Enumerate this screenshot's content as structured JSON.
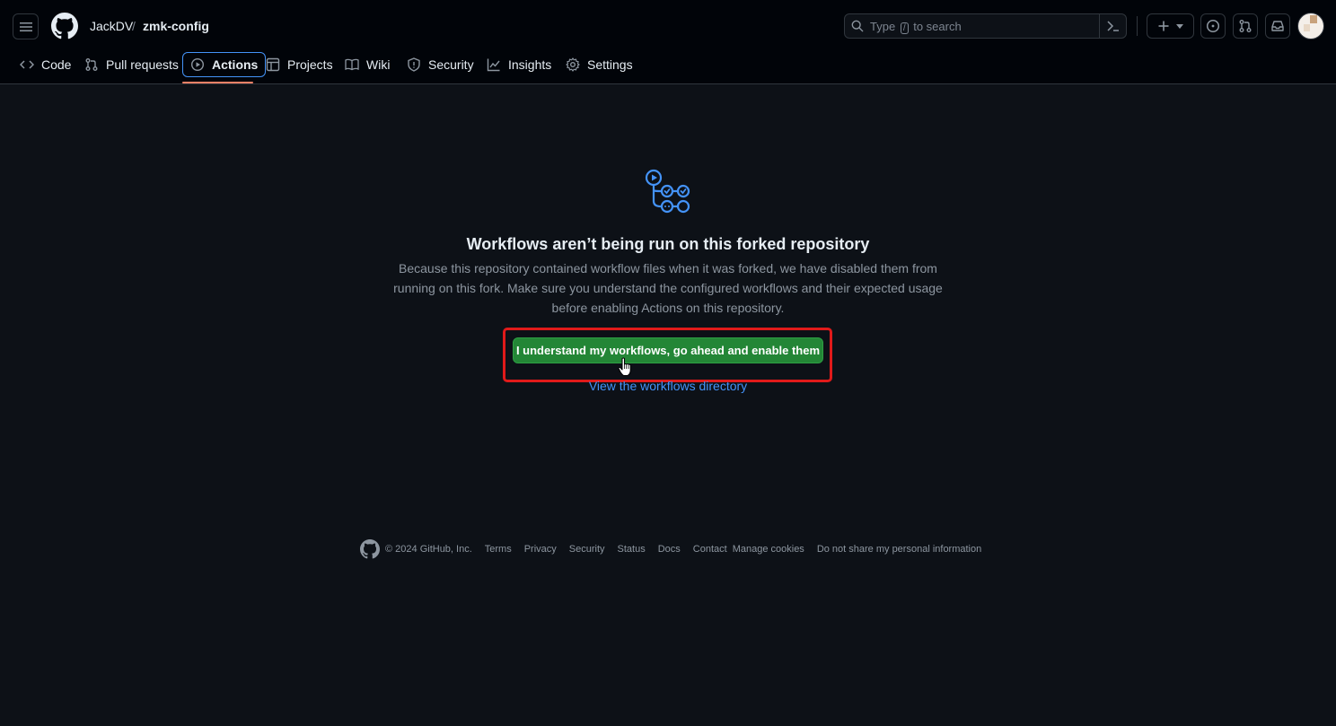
{
  "header": {
    "owner": "JackDV",
    "separator": "/",
    "repo": "zmk-config",
    "search": {
      "prefix": "Type",
      "key": "/",
      "suffix": "to search"
    }
  },
  "tabs": [
    {
      "label": "Code",
      "icon": "code-icon"
    },
    {
      "label": "Pull requests",
      "icon": "git-pull-request-icon"
    },
    {
      "label": "Actions",
      "icon": "play-icon"
    },
    {
      "label": "Projects",
      "icon": "table-icon"
    },
    {
      "label": "Wiki",
      "icon": "book-icon"
    },
    {
      "label": "Security",
      "icon": "shield-icon"
    },
    {
      "label": "Insights",
      "icon": "graph-icon"
    },
    {
      "label": "Settings",
      "icon": "gear-icon"
    }
  ],
  "active_tab": "Actions",
  "main": {
    "title": "Workflows aren’t being run on this forked repository",
    "description": "Because this repository contained workflow files when it was forked, we have disabled them from running on this fork. Make sure you understand the configured workflows and their expected usage before enabling Actions on this repository.",
    "enable_button": "I understand my workflows, go ahead and enable them",
    "view_link": "View the workflows directory"
  },
  "footer": {
    "copyright": "© 2024 GitHub, Inc.",
    "links": [
      "Terms",
      "Privacy",
      "Security",
      "Status",
      "Docs",
      "Contact",
      "Manage cookies",
      "Do not share my personal information"
    ]
  },
  "colors": {
    "background": "#0d1117",
    "header": "#010409",
    "primary_button": "#238636",
    "link": "#4493f8",
    "highlight": "#e01a1a",
    "active_underline": "#f78166"
  }
}
